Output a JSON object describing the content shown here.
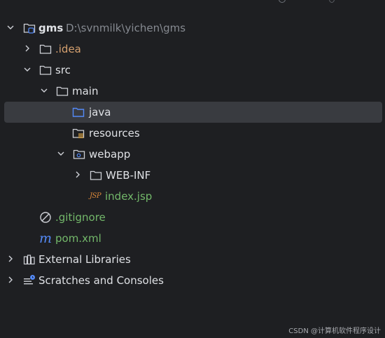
{
  "tree": {
    "project": {
      "name": "gms",
      "path": "D:\\svnmilk\\yichen\\gms"
    },
    "items": [
      {
        "label": "gms",
        "path": "D:\\svnmilk\\yichen\\gms",
        "icon": "project-folder-icon",
        "expanded": true
      },
      {
        "label": ".idea",
        "icon": "folder-icon",
        "expanded": false
      },
      {
        "label": "src",
        "icon": "folder-icon",
        "expanded": true
      },
      {
        "label": "main",
        "icon": "folder-icon",
        "expanded": true
      },
      {
        "label": "java",
        "icon": "source-root-folder-icon",
        "selected": true
      },
      {
        "label": "resources",
        "icon": "resources-folder-icon"
      },
      {
        "label": "webapp",
        "icon": "web-folder-icon",
        "expanded": true
      },
      {
        "label": "WEB-INF",
        "icon": "folder-icon",
        "expanded": false
      },
      {
        "label": "index.jsp",
        "icon": "jsp-file-icon"
      },
      {
        "label": ".gitignore",
        "icon": "ignore-file-icon"
      },
      {
        "label": "pom.xml",
        "icon": "maven-file-icon"
      },
      {
        "label": "External Libraries",
        "icon": "libraries-icon",
        "expanded": false
      },
      {
        "label": "Scratches and Consoles",
        "icon": "scratches-icon",
        "expanded": false
      }
    ],
    "jsp_badge": "JSP",
    "maven_badge": "m"
  },
  "watermark": "CSDN @计算机软件程序设计",
  "colors": {
    "background": "#1e1f22",
    "selection": "#393b40",
    "text": "#dfe1e5",
    "path": "#868a91",
    "excluded": "#d5a06f",
    "untracked": "#73b86a",
    "source_root": "#548af7"
  }
}
